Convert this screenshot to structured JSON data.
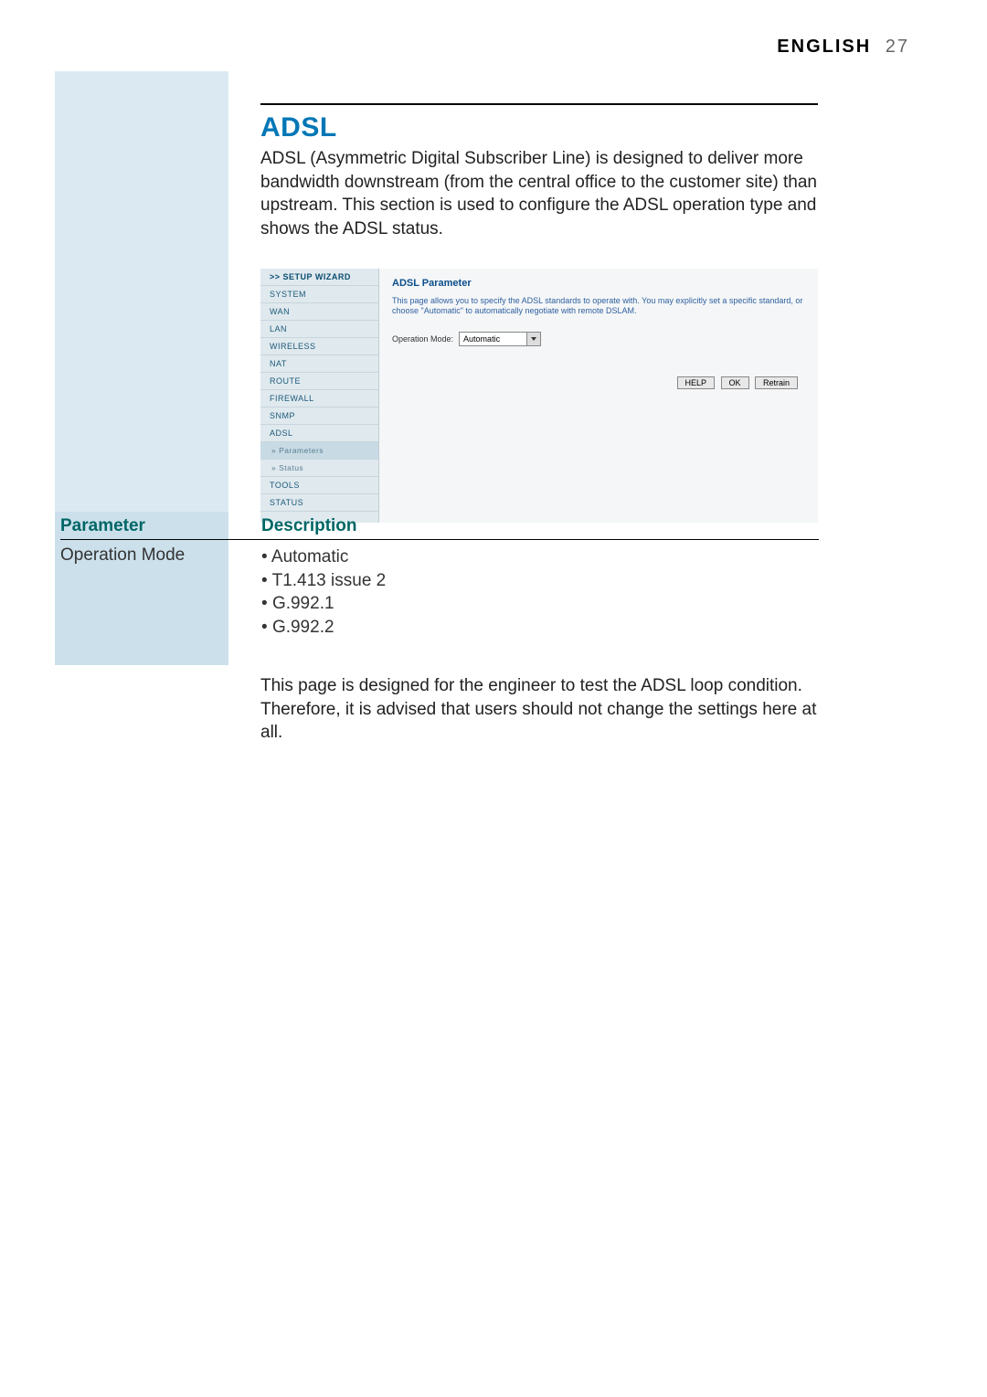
{
  "header": {
    "lang": "ENGLISH",
    "page": "27"
  },
  "section": {
    "title": "ADSL",
    "intro": "ADSL (Asymmetric Digital Subscriber Line) is designed to deliver more bandwidth downstream (from the central office to the customer site) than upstream. This section is used to configure the ADSL operation type and shows the ADSL status."
  },
  "shot": {
    "nav": {
      "setup": ">> SETUP WIZARD",
      "items": [
        "SYSTEM",
        "WAN",
        "LAN",
        "WIRELESS",
        "NAT",
        "ROUTE",
        "FIREWALL",
        "SNMP",
        "ADSL"
      ],
      "sub": [
        "» Parameters",
        "» Status"
      ],
      "tail": [
        "TOOLS",
        "STATUS"
      ]
    },
    "title": "ADSL Parameter",
    "desc": "This page allows you to specify the ADSL standards to operate with. You may explicitly set a specific standard, or choose \"Automatic\" to automatically negotiate with remote DSLAM.",
    "op_label": "Operation Mode:",
    "op_value": "Automatic",
    "buttons": {
      "help": "HELP",
      "ok": "OK",
      "retrain": "Retrain"
    }
  },
  "table": {
    "head_l": "Parameter",
    "head_r": "Description",
    "row_l": "Operation Mode",
    "bullets": [
      "Automatic",
      "T1.413 issue 2",
      "G.992.1",
      "G.992.2"
    ]
  },
  "closing": "This page is designed for the engineer to test the ADSL loop condition. Therefore, it is advised that users should not change the settings here at all."
}
